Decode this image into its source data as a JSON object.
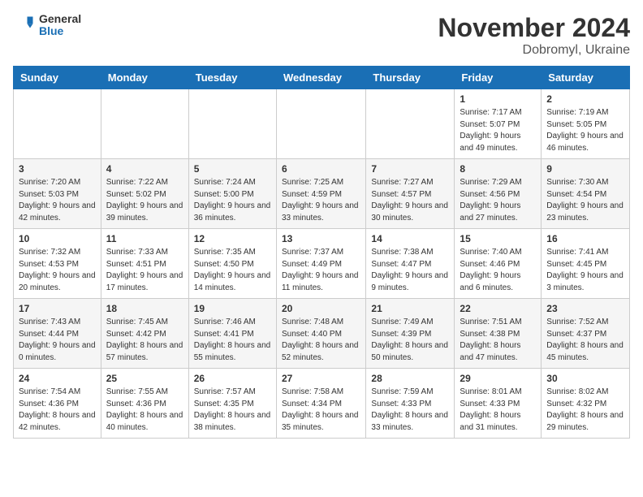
{
  "header": {
    "logo_general": "General",
    "logo_blue": "Blue",
    "month_title": "November 2024",
    "subtitle": "Dobromyl, Ukraine"
  },
  "days_of_week": [
    "Sunday",
    "Monday",
    "Tuesday",
    "Wednesday",
    "Thursday",
    "Friday",
    "Saturday"
  ],
  "weeks": [
    [
      {
        "day": "",
        "sunrise": "",
        "sunset": "",
        "daylight": ""
      },
      {
        "day": "",
        "sunrise": "",
        "sunset": "",
        "daylight": ""
      },
      {
        "day": "",
        "sunrise": "",
        "sunset": "",
        "daylight": ""
      },
      {
        "day": "",
        "sunrise": "",
        "sunset": "",
        "daylight": ""
      },
      {
        "day": "",
        "sunrise": "",
        "sunset": "",
        "daylight": ""
      },
      {
        "day": "1",
        "sunrise": "Sunrise: 7:17 AM",
        "sunset": "Sunset: 5:07 PM",
        "daylight": "Daylight: 9 hours and 49 minutes."
      },
      {
        "day": "2",
        "sunrise": "Sunrise: 7:19 AM",
        "sunset": "Sunset: 5:05 PM",
        "daylight": "Daylight: 9 hours and 46 minutes."
      }
    ],
    [
      {
        "day": "3",
        "sunrise": "Sunrise: 7:20 AM",
        "sunset": "Sunset: 5:03 PM",
        "daylight": "Daylight: 9 hours and 42 minutes."
      },
      {
        "day": "4",
        "sunrise": "Sunrise: 7:22 AM",
        "sunset": "Sunset: 5:02 PM",
        "daylight": "Daylight: 9 hours and 39 minutes."
      },
      {
        "day": "5",
        "sunrise": "Sunrise: 7:24 AM",
        "sunset": "Sunset: 5:00 PM",
        "daylight": "Daylight: 9 hours and 36 minutes."
      },
      {
        "day": "6",
        "sunrise": "Sunrise: 7:25 AM",
        "sunset": "Sunset: 4:59 PM",
        "daylight": "Daylight: 9 hours and 33 minutes."
      },
      {
        "day": "7",
        "sunrise": "Sunrise: 7:27 AM",
        "sunset": "Sunset: 4:57 PM",
        "daylight": "Daylight: 9 hours and 30 minutes."
      },
      {
        "day": "8",
        "sunrise": "Sunrise: 7:29 AM",
        "sunset": "Sunset: 4:56 PM",
        "daylight": "Daylight: 9 hours and 27 minutes."
      },
      {
        "day": "9",
        "sunrise": "Sunrise: 7:30 AM",
        "sunset": "Sunset: 4:54 PM",
        "daylight": "Daylight: 9 hours and 23 minutes."
      }
    ],
    [
      {
        "day": "10",
        "sunrise": "Sunrise: 7:32 AM",
        "sunset": "Sunset: 4:53 PM",
        "daylight": "Daylight: 9 hours and 20 minutes."
      },
      {
        "day": "11",
        "sunrise": "Sunrise: 7:33 AM",
        "sunset": "Sunset: 4:51 PM",
        "daylight": "Daylight: 9 hours and 17 minutes."
      },
      {
        "day": "12",
        "sunrise": "Sunrise: 7:35 AM",
        "sunset": "Sunset: 4:50 PM",
        "daylight": "Daylight: 9 hours and 14 minutes."
      },
      {
        "day": "13",
        "sunrise": "Sunrise: 7:37 AM",
        "sunset": "Sunset: 4:49 PM",
        "daylight": "Daylight: 9 hours and 11 minutes."
      },
      {
        "day": "14",
        "sunrise": "Sunrise: 7:38 AM",
        "sunset": "Sunset: 4:47 PM",
        "daylight": "Daylight: 9 hours and 9 minutes."
      },
      {
        "day": "15",
        "sunrise": "Sunrise: 7:40 AM",
        "sunset": "Sunset: 4:46 PM",
        "daylight": "Daylight: 9 hours and 6 minutes."
      },
      {
        "day": "16",
        "sunrise": "Sunrise: 7:41 AM",
        "sunset": "Sunset: 4:45 PM",
        "daylight": "Daylight: 9 hours and 3 minutes."
      }
    ],
    [
      {
        "day": "17",
        "sunrise": "Sunrise: 7:43 AM",
        "sunset": "Sunset: 4:44 PM",
        "daylight": "Daylight: 9 hours and 0 minutes."
      },
      {
        "day": "18",
        "sunrise": "Sunrise: 7:45 AM",
        "sunset": "Sunset: 4:42 PM",
        "daylight": "Daylight: 8 hours and 57 minutes."
      },
      {
        "day": "19",
        "sunrise": "Sunrise: 7:46 AM",
        "sunset": "Sunset: 4:41 PM",
        "daylight": "Daylight: 8 hours and 55 minutes."
      },
      {
        "day": "20",
        "sunrise": "Sunrise: 7:48 AM",
        "sunset": "Sunset: 4:40 PM",
        "daylight": "Daylight: 8 hours and 52 minutes."
      },
      {
        "day": "21",
        "sunrise": "Sunrise: 7:49 AM",
        "sunset": "Sunset: 4:39 PM",
        "daylight": "Daylight: 8 hours and 50 minutes."
      },
      {
        "day": "22",
        "sunrise": "Sunrise: 7:51 AM",
        "sunset": "Sunset: 4:38 PM",
        "daylight": "Daylight: 8 hours and 47 minutes."
      },
      {
        "day": "23",
        "sunrise": "Sunrise: 7:52 AM",
        "sunset": "Sunset: 4:37 PM",
        "daylight": "Daylight: 8 hours and 45 minutes."
      }
    ],
    [
      {
        "day": "24",
        "sunrise": "Sunrise: 7:54 AM",
        "sunset": "Sunset: 4:36 PM",
        "daylight": "Daylight: 8 hours and 42 minutes."
      },
      {
        "day": "25",
        "sunrise": "Sunrise: 7:55 AM",
        "sunset": "Sunset: 4:36 PM",
        "daylight": "Daylight: 8 hours and 40 minutes."
      },
      {
        "day": "26",
        "sunrise": "Sunrise: 7:57 AM",
        "sunset": "Sunset: 4:35 PM",
        "daylight": "Daylight: 8 hours and 38 minutes."
      },
      {
        "day": "27",
        "sunrise": "Sunrise: 7:58 AM",
        "sunset": "Sunset: 4:34 PM",
        "daylight": "Daylight: 8 hours and 35 minutes."
      },
      {
        "day": "28",
        "sunrise": "Sunrise: 7:59 AM",
        "sunset": "Sunset: 4:33 PM",
        "daylight": "Daylight: 8 hours and 33 minutes."
      },
      {
        "day": "29",
        "sunrise": "Sunrise: 8:01 AM",
        "sunset": "Sunset: 4:33 PM",
        "daylight": "Daylight: 8 hours and 31 minutes."
      },
      {
        "day": "30",
        "sunrise": "Sunrise: 8:02 AM",
        "sunset": "Sunset: 4:32 PM",
        "daylight": "Daylight: 8 hours and 29 minutes."
      }
    ]
  ]
}
